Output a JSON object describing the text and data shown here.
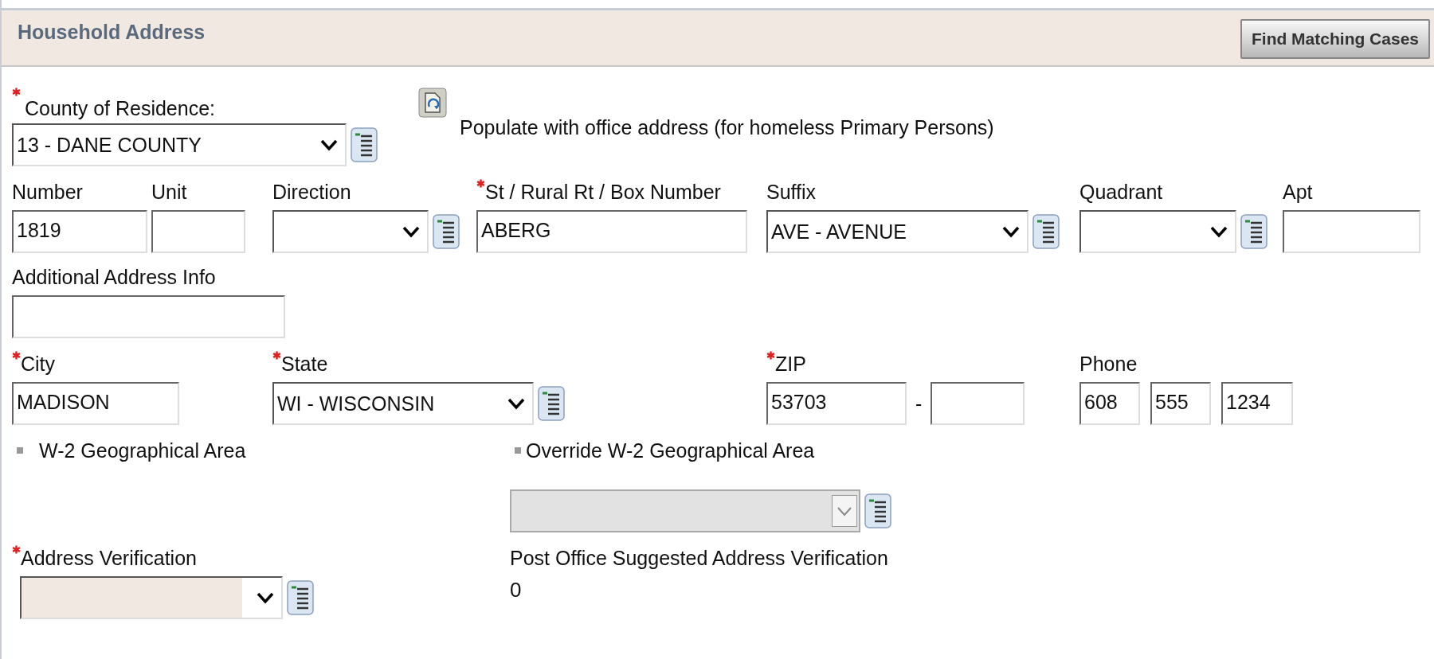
{
  "section": {
    "title": "Household Address",
    "button": "Find Matching Cases"
  },
  "county": {
    "label": "County of Residence:",
    "required": true,
    "value": "13 - DANE COUNTY"
  },
  "populate": {
    "label": "Populate with office address (for homeless Primary Persons)"
  },
  "street_row": [
    {
      "label": "Number",
      "required": false,
      "kind": "text",
      "value": "1819"
    },
    {
      "label": "Unit",
      "required": false,
      "kind": "text"
    },
    {
      "label": "Direction",
      "required": false,
      "kind": "select"
    },
    {
      "label": "St / Rural Rt / Box Number",
      "required": true,
      "kind": "text",
      "value": "ABERG"
    },
    {
      "label": "Suffix",
      "required": false,
      "kind": "select",
      "value": "AVE - AVENUE"
    },
    {
      "label": "Quadrant",
      "required": false,
      "kind": "select"
    },
    {
      "label": "Apt",
      "required": false,
      "kind": "text"
    }
  ],
  "additional": {
    "label": "Additional Address Info"
  },
  "city_row": [
    {
      "label": "City",
      "required": true,
      "kind": "text",
      "value": "MADISON"
    },
    {
      "label": "State",
      "required": true,
      "kind": "select",
      "value": "WI - WISCONSIN"
    },
    {
      "label": "ZIP",
      "required": true,
      "kind": "zip",
      "values": [
        "53703"
      ],
      "separator": "-"
    },
    {
      "label": "Phone",
      "required": false,
      "kind": "phone",
      "values": [
        "608",
        "555",
        "1234"
      ]
    }
  ],
  "w2": {
    "label": "W-2 Geographical Area"
  },
  "override": {
    "label": "Override W-2 Geographical Area",
    "disabled": true
  },
  "verification": {
    "label": "Address Verification",
    "required": true
  },
  "post_office": {
    "label": "Post Office Suggested Address Verification",
    "value": "0"
  }
}
